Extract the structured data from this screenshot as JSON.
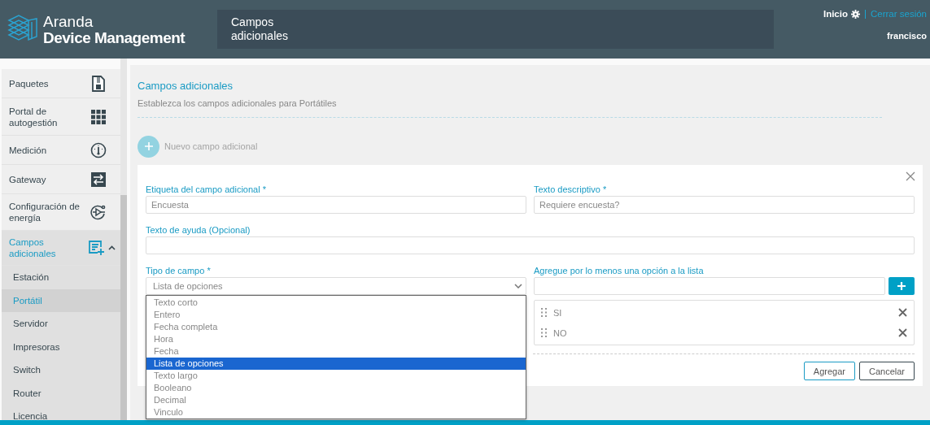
{
  "header": {
    "logo_line1": "Aranda",
    "logo_line2": "Device Management",
    "breadcrumb": "Campos adicionales",
    "home_link": "Inicio",
    "logout_link": "Cerrar sesión",
    "user": "francisco"
  },
  "sidebar": {
    "items": [
      {
        "label": "Paquetes",
        "selected": false
      },
      {
        "label": "Portal de autogestión",
        "selected": false
      },
      {
        "label": "Medición",
        "selected": false
      },
      {
        "label": "Gateway",
        "selected": false
      },
      {
        "label": "Configuración de energía",
        "selected": false
      },
      {
        "label": "Campos adicionales",
        "selected": true,
        "expanded": true,
        "children": [
          {
            "label": "Estación",
            "selected": false
          },
          {
            "label": "Portátil",
            "selected": true
          },
          {
            "label": "Servidor",
            "selected": false
          },
          {
            "label": "Impresoras",
            "selected": false
          },
          {
            "label": "Switch",
            "selected": false
          },
          {
            "label": "Router",
            "selected": false
          },
          {
            "label": "Licencia",
            "selected": false
          }
        ]
      }
    ]
  },
  "main": {
    "title": "Campos adicionales",
    "subtitle": "Establezca los campos adicionales para Portátiles",
    "new_button": {
      "label": "Nuevo campo adicional",
      "disabled": true
    }
  },
  "form": {
    "label_field": {
      "label": "Etiqueta del campo adicional *",
      "value": "Encuesta"
    },
    "description_field": {
      "label": "Texto descriptivo *",
      "value": "Requiere encuesta?"
    },
    "help_field": {
      "label": "Texto de ayuda (Opcional)"
    },
    "type_field": {
      "label": "Tipo de campo *",
      "value": "Lista de opciones",
      "expanded": true,
      "options": [
        {
          "label": "Texto corto",
          "selected": false
        },
        {
          "label": "Entero",
          "selected": false
        },
        {
          "label": "Fecha completa",
          "selected": false
        },
        {
          "label": "Hora",
          "selected": false
        },
        {
          "label": "Fecha",
          "selected": false
        },
        {
          "label": "Lista de opciones",
          "selected": true
        },
        {
          "label": "Texto largo",
          "selected": false
        },
        {
          "label": "Booleano",
          "selected": false
        },
        {
          "label": "Decimal",
          "selected": false
        },
        {
          "label": "Vinculo",
          "selected": false
        }
      ]
    },
    "options_field": {
      "label": "Agregue por lo menos una opción a la lista",
      "items": [
        "SI",
        "NO"
      ]
    },
    "buttons": [
      {
        "label": "Agregar",
        "kind": "primary"
      },
      {
        "label": "Cancelar",
        "kind": "secondary"
      }
    ]
  }
}
